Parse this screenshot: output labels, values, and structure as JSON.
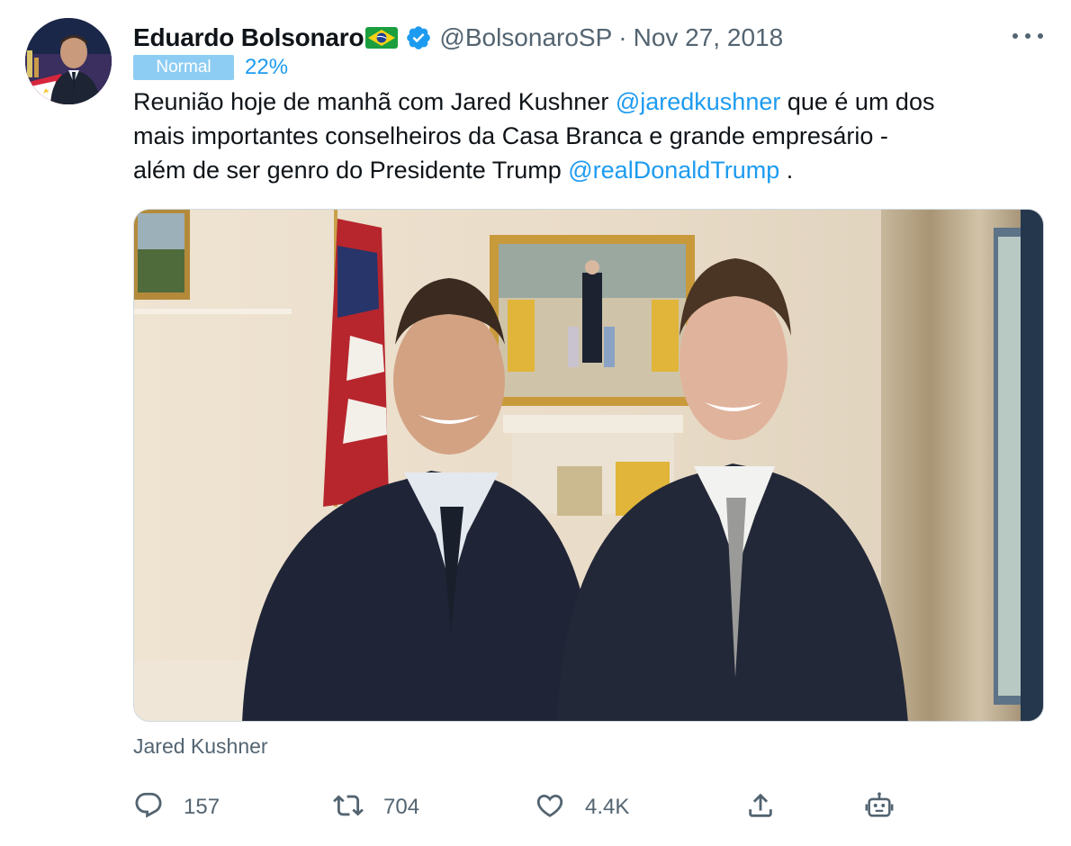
{
  "tweet": {
    "author_name": "Eduardo Bolsonaro",
    "author_flag": "brazil-flag-emoji",
    "verified": true,
    "handle": "@BolsonaroSP",
    "separator": "·",
    "date": "Nov 27, 2018",
    "badge_label": "Normal",
    "badge_percent": "22%",
    "text_lines": [
      [
        {
          "text": "Reunião hoje de manhã com Jared Kushner ",
          "mention": false
        },
        {
          "text": "@jaredkushner",
          "mention": true
        },
        {
          "text": " que é um dos",
          "mention": false
        }
      ],
      [
        {
          "text": "mais importantes conselheiros da Casa Branca e grande empresário -",
          "mention": false
        }
      ],
      [
        {
          "text": "além de ser genro do Presidente Trump ",
          "mention": false
        },
        {
          "text": "@realDonaldTrump",
          "mention": true
        },
        {
          "text": " .",
          "mention": false
        }
      ]
    ],
    "tagged_person": "Jared Kushner",
    "stats": {
      "replies": "157",
      "retweets": "704",
      "likes": "4.4K"
    }
  },
  "icons": {
    "more": "more-horizontal-icon",
    "reply": "reply-icon",
    "retweet": "retweet-icon",
    "like": "heart-icon",
    "share": "share-icon",
    "bot": "robot-icon"
  },
  "colors": {
    "accent": "#1d9bf0",
    "muted_text": "#536471",
    "badge_bg": "#8ecdf3",
    "verified_badge": "#1d9bf0"
  }
}
